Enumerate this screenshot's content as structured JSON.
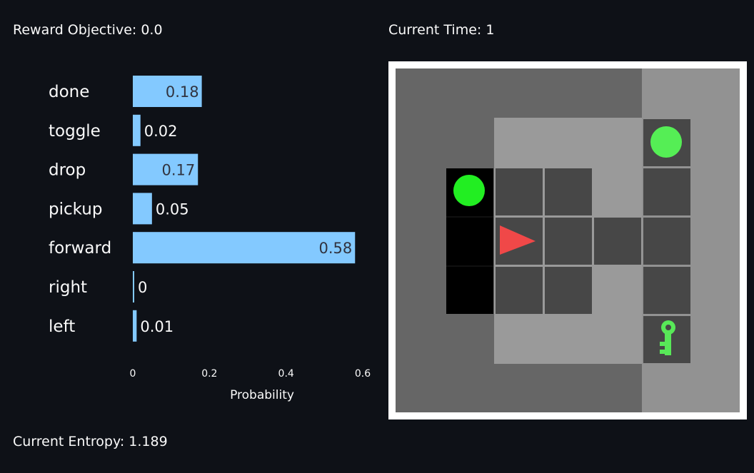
{
  "reward_objective": "Reward Objective: 0.0",
  "current_time": "Current Time: 1",
  "current_entropy": "Current Entropy: 1.189",
  "chart_data": {
    "type": "bar",
    "orientation": "horizontal",
    "categories": [
      "done",
      "toggle",
      "drop",
      "pickup",
      "forward",
      "right",
      "left"
    ],
    "values": [
      0.18,
      0.02,
      0.17,
      0.05,
      0.58,
      0,
      0.01
    ],
    "value_labels": [
      "0.18",
      "0.02",
      "0.17",
      "0.05",
      "0.58",
      "0",
      "0.01"
    ],
    "xlabel": "Probability",
    "ylabel": "",
    "xlim": [
      0,
      0.6
    ],
    "x_ticks": [
      0,
      0.2,
      0.4,
      0.6
    ],
    "x_tick_labels": [
      "0",
      "0.2",
      "0.4",
      "0.6"
    ],
    "bar_color": "#83c9ff",
    "grid": false
  },
  "environment": {
    "agent_color": "#f04848",
    "agent_direction": "right",
    "ball_color": "#33ee33",
    "key_color": "#58e858",
    "items": [
      "green-ball",
      "green-ball",
      "green-key",
      "red-agent"
    ]
  }
}
